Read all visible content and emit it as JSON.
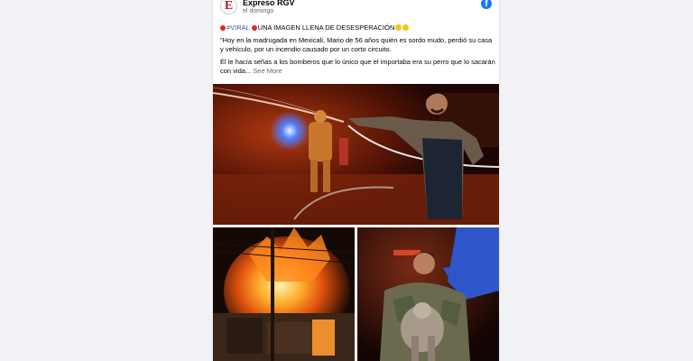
{
  "post": {
    "page_name": "Expreso RGV",
    "avatar_letter": "E",
    "timestamp": "el domingo",
    "hashtag": "#VIRAL",
    "headline": "UNA IMAGEN LLENA DE DESESPERACIÓN",
    "paragraph1": "\"Hoy en la madrugada en Mexicali, Mario de 56 años quién es sordo mudo, perdió su casa y vehículo, por un incendio causado por un corto circuito.",
    "paragraph2": "Él le hacía señas a los bomberos que lo único que el importaba era su perro que lo sacarán con vida... ",
    "see_more": "See More"
  },
  "colors": {
    "facebook_blue": "#1877f2",
    "hashtag_blue": "#385898",
    "brand_red": "#c8102e",
    "emoji_red": "#e02424"
  },
  "icons": [
    "facebook-icon",
    "red-circle-emoji-icon",
    "crying-face-emoji-icon"
  ]
}
